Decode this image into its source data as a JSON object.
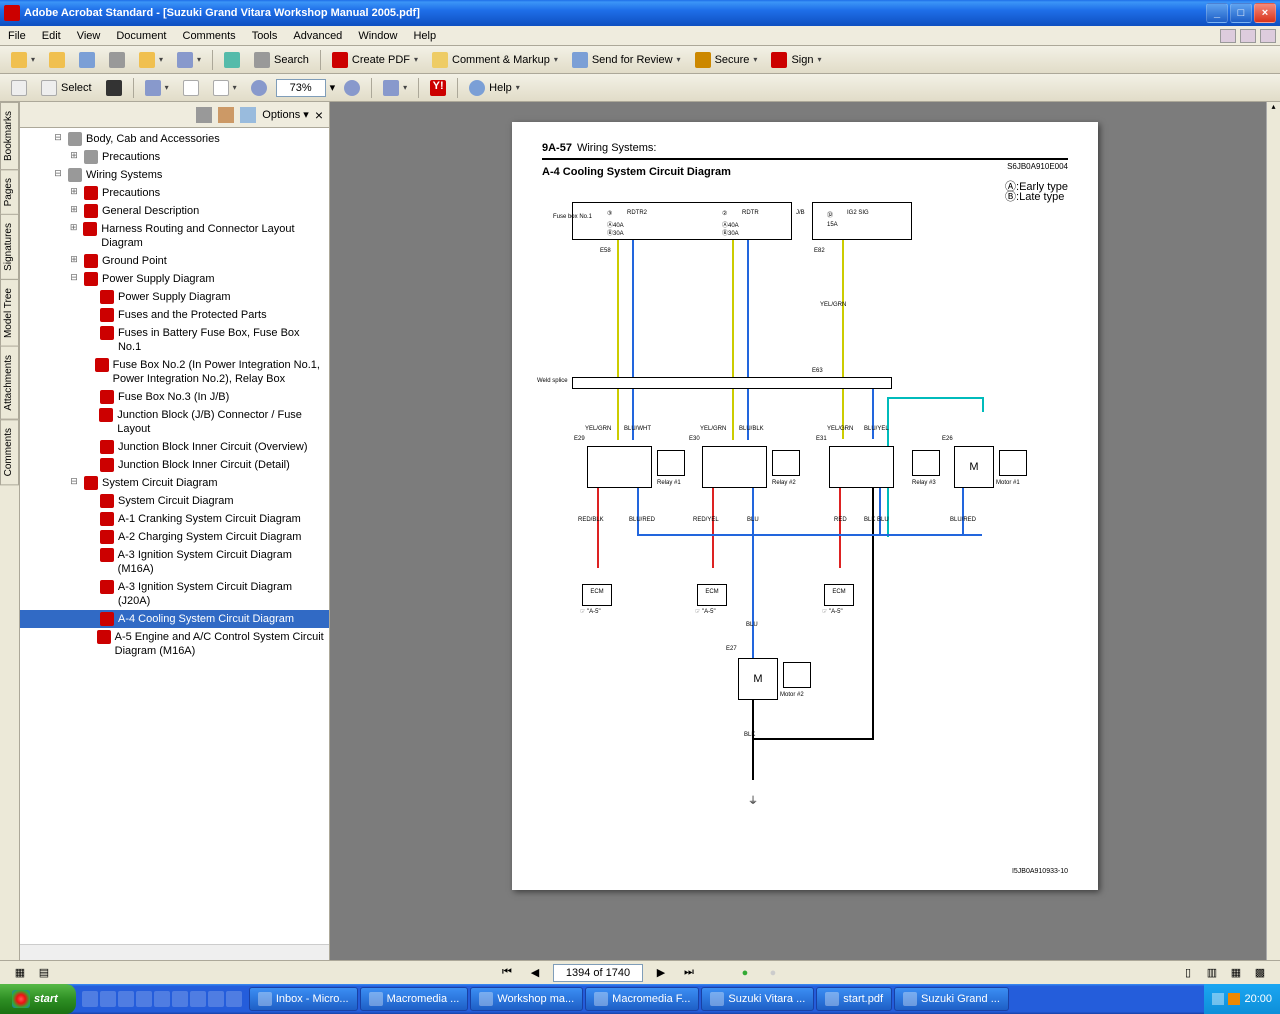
{
  "titlebar": {
    "app": "Adobe Acrobat Standard",
    "doc": "[Suzuki Grand Vitara Workshop Manual 2005.pdf]"
  },
  "menubar": [
    "File",
    "Edit",
    "View",
    "Document",
    "Comments",
    "Tools",
    "Advanced",
    "Window",
    "Help"
  ],
  "toolbar1": {
    "search": "Search",
    "createpdf": "Create PDF",
    "comment": "Comment & Markup",
    "sendreview": "Send for Review",
    "secure": "Secure",
    "sign": "Sign"
  },
  "toolbar2": {
    "select": "Select",
    "zoom": "73%",
    "help": "Help"
  },
  "bookmarks": {
    "options": "Options",
    "items": [
      {
        "indent": 2,
        "exp": "-",
        "ic": "fd",
        "label": "Body, Cab and Accessories"
      },
      {
        "indent": 3,
        "exp": "+",
        "ic": "fd",
        "label": "Precautions"
      },
      {
        "indent": 2,
        "exp": "-",
        "ic": "fd",
        "label": "Wiring Systems"
      },
      {
        "indent": 3,
        "exp": "+",
        "ic": "pg",
        "label": "Precautions"
      },
      {
        "indent": 3,
        "exp": "+",
        "ic": "pg",
        "label": "General Description"
      },
      {
        "indent": 3,
        "exp": "+",
        "ic": "pg",
        "label": "Harness Routing and Connector Layout Diagram"
      },
      {
        "indent": 3,
        "exp": "+",
        "ic": "pg",
        "label": "Ground Point"
      },
      {
        "indent": 3,
        "exp": "-",
        "ic": "pg",
        "label": "Power Supply Diagram"
      },
      {
        "indent": 4,
        "exp": "",
        "ic": "pg",
        "label": "Power Supply Diagram"
      },
      {
        "indent": 4,
        "exp": "",
        "ic": "pg",
        "label": "Fuses and the Protected Parts"
      },
      {
        "indent": 4,
        "exp": "",
        "ic": "pg",
        "label": "Fuses in Battery Fuse Box, Fuse Box No.1"
      },
      {
        "indent": 4,
        "exp": "",
        "ic": "pg",
        "label": "Fuse Box No.2 (In Power Integration No.1, Power Integration No.2), Relay Box"
      },
      {
        "indent": 4,
        "exp": "",
        "ic": "pg",
        "label": "Fuse Box No.3 (In J/B)"
      },
      {
        "indent": 4,
        "exp": "",
        "ic": "pg",
        "label": "Junction Block (J/B) Connector / Fuse Layout"
      },
      {
        "indent": 4,
        "exp": "",
        "ic": "pg",
        "label": "Junction Block Inner Circuit (Overview)"
      },
      {
        "indent": 4,
        "exp": "",
        "ic": "pg",
        "label": "Junction Block Inner Circuit (Detail)"
      },
      {
        "indent": 3,
        "exp": "-",
        "ic": "pg",
        "label": "System Circuit Diagram"
      },
      {
        "indent": 4,
        "exp": "",
        "ic": "pg",
        "label": "System Circuit Diagram"
      },
      {
        "indent": 4,
        "exp": "",
        "ic": "pg",
        "label": "A-1 Cranking System Circuit Diagram"
      },
      {
        "indent": 4,
        "exp": "",
        "ic": "pg",
        "label": "A-2 Charging System Circuit Diagram"
      },
      {
        "indent": 4,
        "exp": "",
        "ic": "pg",
        "label": "A-3 Ignition System Circuit Diagram (M16A)"
      },
      {
        "indent": 4,
        "exp": "",
        "ic": "pg",
        "label": "A-3 Ignition System Circuit Diagram (J20A)"
      },
      {
        "indent": 4,
        "exp": "",
        "ic": "pg",
        "label": "A-4 Cooling System Circuit Diagram",
        "selected": true
      },
      {
        "indent": 4,
        "exp": "",
        "ic": "pg",
        "label": "A-5 Engine and A/C Control System Circuit Diagram (M16A)"
      }
    ]
  },
  "sidetabs": [
    "Bookmarks",
    "Pages",
    "Signatures",
    "Model Tree",
    "Attachments",
    "Comments"
  ],
  "page": {
    "section": "9A-57",
    "sectiontitle": "Wiring Systems:",
    "title": "A-4 Cooling System Circuit Diagram",
    "code": "S6JB0A910E004",
    "legendA": "Ⓐ:Early type",
    "legendB": "Ⓑ:Late type",
    "footercode": "I5JB0A910933-10",
    "fusebox": "Fuse box No.1",
    "fuse3": "③",
    "rdtr2": "RDTR2",
    "fuse3a": "Ⓐ40A",
    "fuse3b": "Ⓑ30A",
    "fuse2": "②",
    "rdtr": "RDTR",
    "fuse2a": "Ⓐ40A",
    "fuse2b": "Ⓑ30A",
    "jb": "J/B",
    "fuse32": "㉜",
    "ig2sig": "IG2 SIG",
    "amp15": "15A",
    "e58": "E58",
    "e82": "E82",
    "e63": "E63",
    "e29": "E29",
    "e30": "E30",
    "e31": "E31",
    "e26": "E26",
    "e27": "E27",
    "relay1": "Relay #1",
    "relay2": "Relay #2",
    "relay3": "Relay #3",
    "motor1": "Motor #1",
    "motor2": "Motor #2",
    "ecm": "ECM",
    "ref": "☞ \"A-5\"",
    "weld": "Weld splice",
    "colors": {
      "yelgrn": "YEL/GRN",
      "bluwht": "BLU/WHT",
      "blublk": "BLU/BLK",
      "bluyel": "BLU/YEL",
      "redblk": "RED/BLK",
      "blured": "BLU/RED",
      "redyel": "RED/YEL",
      "blu": "BLU",
      "red": "RED",
      "blkblu": "BLK BLU",
      "blk": "BLK"
    }
  },
  "nav": {
    "page": "1394 of 1740"
  },
  "taskbar": {
    "start": "start",
    "items": [
      "Inbox - Micro...",
      "Macromedia ...",
      "Workshop ma...",
      "Macromedia F...",
      "Suzuki Vitara ...",
      "start.pdf",
      "Suzuki Grand ..."
    ],
    "time": "20:00"
  }
}
